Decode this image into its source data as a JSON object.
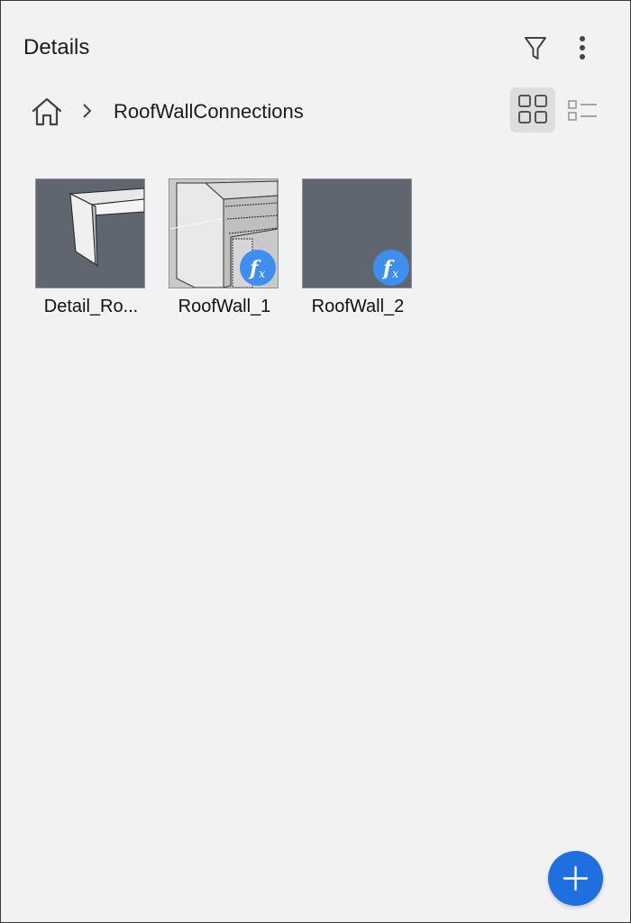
{
  "header": {
    "title": "Details"
  },
  "breadcrumb": {
    "current": "RoofWallConnections"
  },
  "items": [
    {
      "label": "Detail_Ro...",
      "has_formula_badge": false
    },
    {
      "label": "RoofWall_1",
      "has_formula_badge": true
    },
    {
      "label": "RoofWall_2",
      "has_formula_badge": true
    }
  ],
  "icons": {
    "filter": "filter-icon",
    "more": "more-vertical-icon",
    "home": "home-icon",
    "chevron": "chevron-right-icon",
    "grid_view": "grid-view-icon",
    "list_view": "list-view-icon",
    "formula": "formula-fx-icon",
    "add": "plus-icon"
  },
  "colors": {
    "background": "#f2f2f2",
    "thumbnail_bg": "#5f6670",
    "badge": "#3e8ef0",
    "fab": "#1e6fe0",
    "active_view_bg": "#dedede"
  },
  "view_mode": "grid"
}
